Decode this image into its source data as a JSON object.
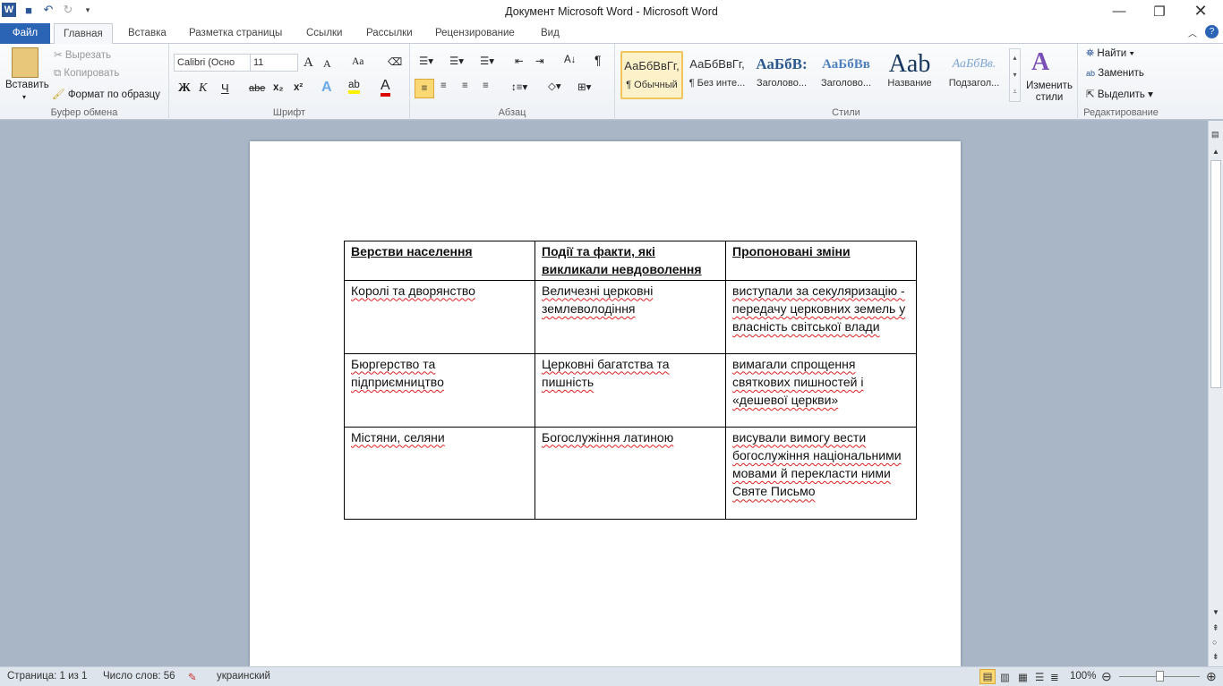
{
  "window": {
    "title": "Документ Microsoft Word  -  Microsoft Word"
  },
  "tabs": [
    "Файл",
    "Главная",
    "Вставка",
    "Разметка страницы",
    "Ссылки",
    "Рассылки",
    "Рецензирование",
    "Вид"
  ],
  "clipboard": {
    "paste": "Вставить",
    "cut": "Вырезать",
    "copy": "Копировать",
    "format_painter": "Формат по образцу",
    "label": "Буфер обмена"
  },
  "font": {
    "name": "Calibri (Осно",
    "size": "11",
    "label": "Шрифт",
    "bold": "Ж",
    "italic": "К",
    "underline": "Ч",
    "strike": "abe",
    "sub": "x₂",
    "sup": "x²",
    "grow": "A",
    "shrink": "A",
    "case": "Aa"
  },
  "paragraph": {
    "label": "Абзац"
  },
  "styles": {
    "label": "Стили",
    "items": [
      {
        "preview": "АаБбВвГг,",
        "name": "¶ Обычный"
      },
      {
        "preview": "АаБбВвГг,",
        "name": "¶ Без инте..."
      },
      {
        "preview": "АаБбВ:",
        "name": "Заголово..."
      },
      {
        "preview": "АаБбВв",
        "name": "Заголово..."
      },
      {
        "preview": "Aab",
        "name": "Название"
      },
      {
        "preview": "АаБбВв.",
        "name": "Подзагол..."
      }
    ],
    "change": "Изменить стили"
  },
  "editing": {
    "label": "Редактирование",
    "find": "Найти",
    "replace": "Заменить",
    "select": "Выделить"
  },
  "table": {
    "headers": [
      "Верстви  населення",
      "Події та факти,  які викликали  невдоволення",
      "Пропоновані  зміни"
    ],
    "rows": [
      [
        "Королі та дворянство",
        "Величезні церковні землеволодіння",
        "виступали за секуляризацію - передачу церковних земель у власність світської влади"
      ],
      [
        "Бюргерство та підприємництво",
        "Церковні багатства та пишність",
        "вимагали спрощення святкових пишностей і «дешевої церкви»"
      ],
      [
        "Містяни, селяни",
        "Богослужіння латиною",
        "висували вимогу вести богослужіння національними мовами й перекласти ними Святе Письмо"
      ]
    ]
  },
  "status": {
    "page": "Страница: 1 из 1",
    "words": "Число слов: 56",
    "language": "украинский",
    "zoom": "100%"
  }
}
